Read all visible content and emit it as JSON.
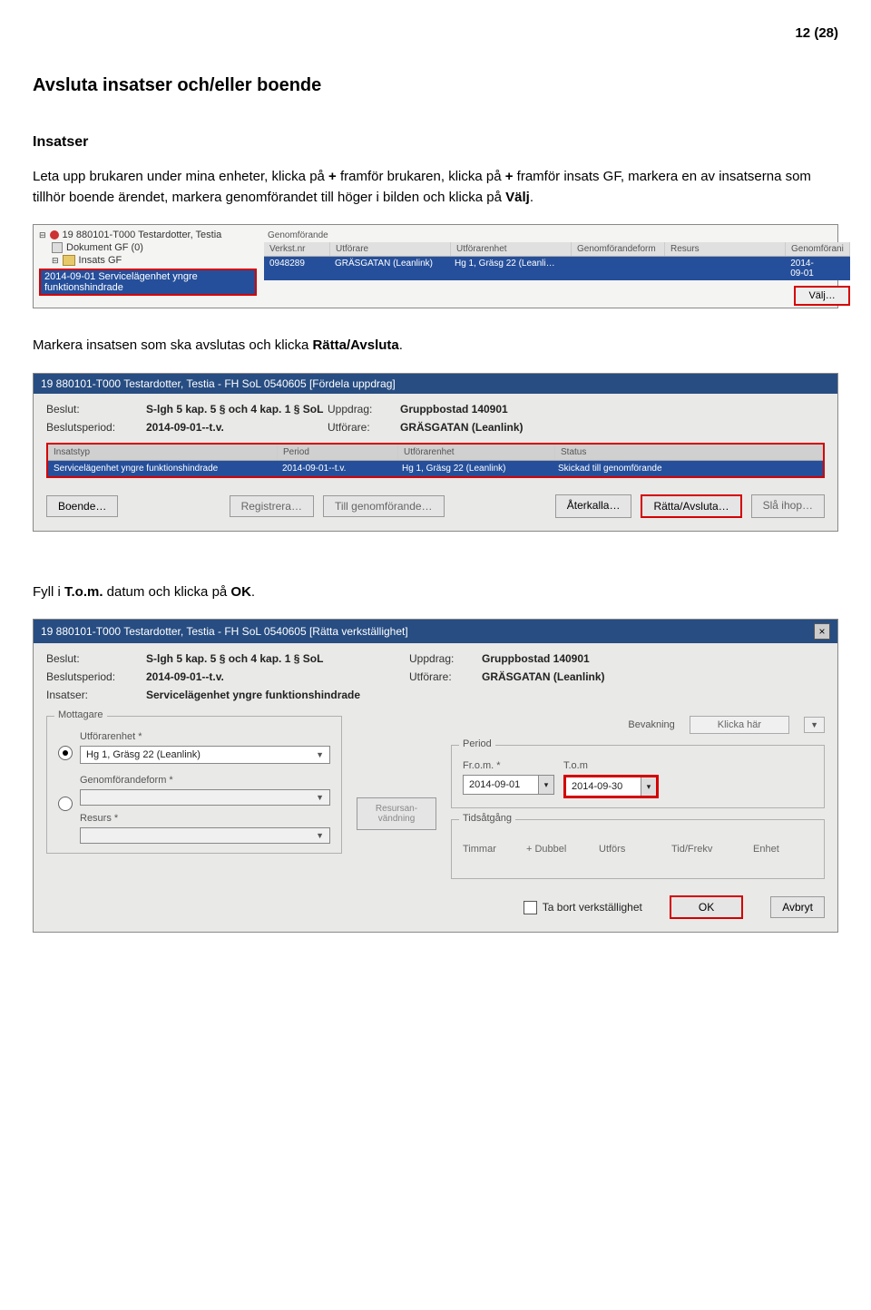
{
  "page_number": "12 (28)",
  "heading": "Avsluta insatser och/eller  boende",
  "subheading": "Insatser",
  "para1_before": "Leta upp brukaren under mina enheter, klicka på ",
  "para1_plus1": "+",
  "para1_mid1": " framför brukaren, klicka på ",
  "para1_plus2": "+",
  "para1_mid2": " framför insats GF, markera en av insatserna som tillhör boende ärendet, markera genomförandet till höger i bilden och klicka på ",
  "para1_valj": "Välj",
  "para1_end": ".",
  "shot1": {
    "tree": {
      "row1": "19 880101-T000 Testardotter, Testia",
      "row2": "Dokument GF (0)",
      "row3": "Insats GF",
      "row4": "2014-09-01 Servicelägenhet yngre funktionshindrade"
    },
    "panel_title": "Genomförande",
    "cols": {
      "c1": "Verkst.nr",
      "c2": "Utförare",
      "c3": "Utförarenhet",
      "c4": "Genomförandeform",
      "c5": "Resurs",
      "c6": "Genomförani"
    },
    "row": {
      "c1": "0948289",
      "c2": "GRÄSGATAN (Leanlink)",
      "c3": "Hg 1, Gräsg 22 (Leanli…",
      "c6": "2014-09-01"
    },
    "btn": "Välj…"
  },
  "para2_before": "Markera insatsen som ska avslutas och klicka ",
  "para2_bold": "Rätta/Avsluta",
  "para2_end": ".",
  "shot2": {
    "title": "19 880101-T000  Testardotter, Testia  -  FH SoL  0540605  [Fördela uppdrag]",
    "labels": {
      "beslut": "Beslut:",
      "period": "Beslutsperiod:",
      "uppdrag": "Uppdrag:",
      "utforare": "Utförare:"
    },
    "vals": {
      "beslut": "S-lgh 5 kap. 5 § och 4 kap. 1 § SoL",
      "period": "2014-09-01--t.v.",
      "uppdrag": "Gruppbostad 140901",
      "utforare": "GRÄSGATAN (Leanlink)"
    },
    "cols": {
      "c1": "Insatstyp",
      "c2": "Period",
      "c3": "Utförarenhet",
      "c4": "Status"
    },
    "row": {
      "c1": "Servicelägenhet yngre funktionshindrade",
      "c2": "2014-09-01--t.v.",
      "c3": "Hg 1, Gräsg 22 (Leanlink)",
      "c4": "Skickad till genomförande"
    },
    "btns": {
      "boende": "Boende…",
      "reg": "Registrera…",
      "till": "Till genomförande…",
      "aterkalla": "Återkalla…",
      "ratta": "Rätta/Avsluta…",
      "sla": "Slå ihop…"
    }
  },
  "para3_before": "Fyll i ",
  "para3_bold": "T.o.m.",
  "para3_mid": " datum och klicka på ",
  "para3_bold2": "OK",
  "para3_end": ".",
  "shot3": {
    "title": "19 880101-T000  Testardotter, Testia  -  FH SoL  0540605  [Rätta verkställighet]",
    "labels": {
      "beslut": "Beslut:",
      "period": "Beslutsperiod:",
      "insatser": "Insatser:",
      "uppdrag": "Uppdrag:",
      "utforare": "Utförare:"
    },
    "vals": {
      "beslut": "S-lgh 5 kap. 5 § och 4 kap. 1 § SoL",
      "period": "2014-09-01--t.v.",
      "insatser": "Servicelägenhet yngre funktionshindrade",
      "uppdrag": "Gruppbostad 140901",
      "utforare": "GRÄSGATAN (Leanlink)"
    },
    "mottagare": {
      "legend": "Mottagare",
      "utforarenhet_lbl": "Utförarenhet *",
      "utforarenhet_val": "Hg 1, Gräsg 22 (Leanlink)",
      "genomf_lbl": "Genomförandeform *",
      "resurs_lbl": "Resurs *"
    },
    "resursan": "Resursan-\nvändning",
    "bevakning_lbl": "Bevakning",
    "bevakning_btn": "Klicka här",
    "period": {
      "legend": "Period",
      "from_lbl": "Fr.o.m. *",
      "tom_lbl": "T.o.m",
      "from_val": "2014-09-01",
      "tom_val": "2014-09-30"
    },
    "tids": {
      "legend": "Tidsåtgång",
      "c1": "Timmar",
      "c2": "+ Dubbel",
      "c3": "Utförs",
      "c4": "Tid/Frekv",
      "c5": "Enhet"
    },
    "bottom": {
      "chk": "Ta bort verkställighet",
      "ok": "OK",
      "avbryt": "Avbryt"
    }
  }
}
